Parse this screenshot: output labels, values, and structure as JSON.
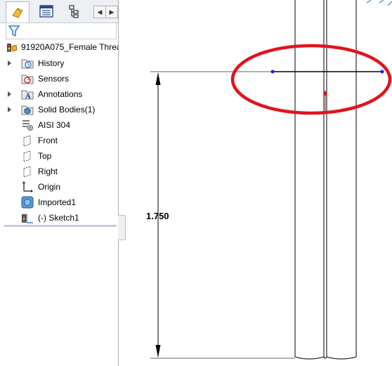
{
  "tree": {
    "root_label": "91920A075_Female Threac",
    "items": [
      {
        "label": "History",
        "icon": "history-folder-icon",
        "expandable": true
      },
      {
        "label": "Sensors",
        "icon": "sensors-icon",
        "expandable": false
      },
      {
        "label": "Annotations",
        "icon": "annotations-icon",
        "expandable": true
      },
      {
        "label": "Solid Bodies(1)",
        "icon": "solid-bodies-icon",
        "expandable": true
      },
      {
        "label": "AISI 304",
        "icon": "material-icon",
        "expandable": false
      },
      {
        "label": "Front",
        "icon": "plane-icon",
        "expandable": false
      },
      {
        "label": "Top",
        "icon": "plane-icon",
        "expandable": false
      },
      {
        "label": "Right",
        "icon": "plane-icon",
        "expandable": false
      },
      {
        "label": "Origin",
        "icon": "origin-icon",
        "expandable": false
      },
      {
        "label": "Imported1",
        "icon": "imported-body-icon",
        "expandable": false
      },
      {
        "label": "(-) Sketch1",
        "icon": "sketch-icon",
        "expandable": false
      }
    ]
  },
  "tabs": [
    "feature-manager-tab",
    "property-manager-tab",
    "configuration-manager-tab"
  ],
  "drawing": {
    "dimension_value": "1.750",
    "highlight_color": "#e0141e",
    "line_color": "#000000",
    "selection_color": "#1a1aff"
  }
}
